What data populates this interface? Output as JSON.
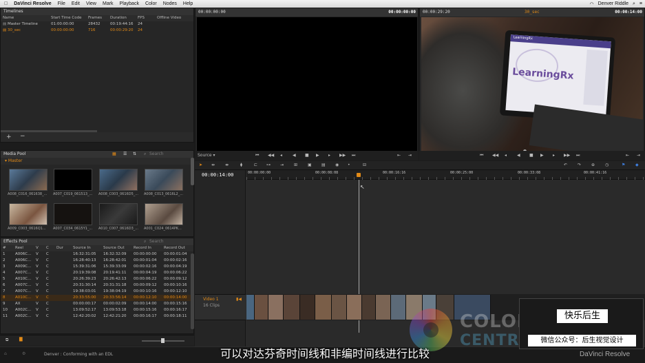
{
  "menubar": {
    "apple": "",
    "app": "DaVinci Resolve",
    "items": [
      "File",
      "Edit",
      "View",
      "Mark",
      "Playback",
      "Color",
      "Nodes",
      "Help"
    ],
    "user": "Denver Riddle"
  },
  "timelines": {
    "title": "Timelines",
    "columns": [
      "Name",
      "Start Time Code",
      "Frames",
      "Duration",
      "FPS",
      "Offline Video"
    ],
    "rows": [
      {
        "name": "Master Timeline",
        "start": "01:00:00:00",
        "frames": "28432",
        "duration": "00:19:44:16",
        "fps": "24",
        "offline": ""
      },
      {
        "name": "30_sec",
        "start": "00:00:00:00",
        "frames": "716",
        "duration": "00:00:29:20",
        "fps": "24",
        "offline": ""
      }
    ]
  },
  "media_pool": {
    "title": "Media Pool",
    "search_placeholder": "Search",
    "bin": "Master",
    "clips": [
      "A008_C016_061638_...",
      "A007_C019_061513_...",
      "A008_C003_0616D5_...",
      "A008_C013_0616L2_...",
      "A009_C003_0616Q1...",
      "A007_C034_0615Y1_...",
      "A010_C007_0616D3_...",
      "A001_C024_0614PK..."
    ]
  },
  "effects_pool": {
    "title": "Effects Pool",
    "search_placeholder": "Search",
    "columns": [
      "#",
      "Reel",
      "V",
      "C",
      "Dur",
      "Source In",
      "Source Out",
      "Record In",
      "Record Out"
    ],
    "rows": [
      [
        "1",
        "A006C...",
        "V",
        "C",
        "",
        "16:32:31:05",
        "16:32:32:09",
        "00:00:00:00",
        "00:00:01:04"
      ],
      [
        "2",
        "A006C...",
        "V",
        "C",
        "",
        "16:28:40:13",
        "16:28:42:01",
        "00:00:01:04",
        "00:00:02:16"
      ],
      [
        "3",
        "A009C...",
        "V",
        "C",
        "",
        "15:39:31:06",
        "15:39:33:09",
        "00:00:02:16",
        "00:00:04:19"
      ],
      [
        "4",
        "A007C...",
        "V",
        "C",
        "",
        "20:19:39:08",
        "20:19:41:11",
        "00:00:04:19",
        "00:00:06:22"
      ],
      [
        "5",
        "A010C...",
        "V",
        "C",
        "",
        "20:26:39:23",
        "20:26:42:13",
        "00:00:06:22",
        "00:00:09:12"
      ],
      [
        "6",
        "A007C...",
        "V",
        "C",
        "",
        "20:31:30:14",
        "20:31:31:18",
        "00:00:09:12",
        "00:00:10:16"
      ],
      [
        "7",
        "A007C...",
        "V",
        "C",
        "",
        "19:38:03:01",
        "19:38:04:19",
        "00:00:10:16",
        "00:00:12:10"
      ],
      [
        "8",
        "A010C...",
        "V",
        "C",
        "",
        "20:33:55:00",
        "20:33:56:14",
        "00:00:12:10",
        "00:00:14:00"
      ],
      [
        "9",
        "AX",
        "V",
        "C",
        "",
        "00:00:00:17",
        "00:00:02:09",
        "00:00:14:00",
        "00:00:15:16"
      ],
      [
        "10",
        "A002C...",
        "V",
        "C",
        "",
        "13:09:52:17",
        "13:09:53:18",
        "00:00:15:16",
        "00:00:16:17"
      ],
      [
        "11",
        "A002C...",
        "V",
        "C",
        "",
        "12:42:20:02",
        "12:42:21:20",
        "00:00:16:17",
        "00:00:18:11"
      ]
    ]
  },
  "source_viewer": {
    "tc_left": "00:00:00:00",
    "tc_right": "00:00:00:00",
    "mode": "Source"
  },
  "record_viewer": {
    "tc_left": "00:00:29:20",
    "title": "30_sec",
    "tc_right": "00:00:14:00"
  },
  "laptop": {
    "brand": "LearningRx",
    "screen_logo": "LearningRx"
  },
  "timeline": {
    "current_tc": "00:00:14:00",
    "ruler": [
      "00:00:00:00",
      "00:00:08:08",
      "00:00:16:16",
      "00:00:25:00",
      "00:00:33:08",
      "00:00:41:16"
    ],
    "track_name": "Video 1",
    "track_clips": "16 Clips"
  },
  "status": {
    "project": "Denver : Conforming with an EDL"
  },
  "watermark": {
    "line1": "COLOR GRADING",
    "line2": "CENTRAL",
    "brand": "DaVinci Resolve"
  },
  "overlay_card": {
    "line1": "快乐后生",
    "line2": "微信公众号：后生视觉设计"
  },
  "subtitle": "可以对达芬奇时间线和非编时间线进行比较",
  "colors": {
    "accent": "#e28a17",
    "panel": "#262626",
    "bg": "#1c1c1c"
  }
}
